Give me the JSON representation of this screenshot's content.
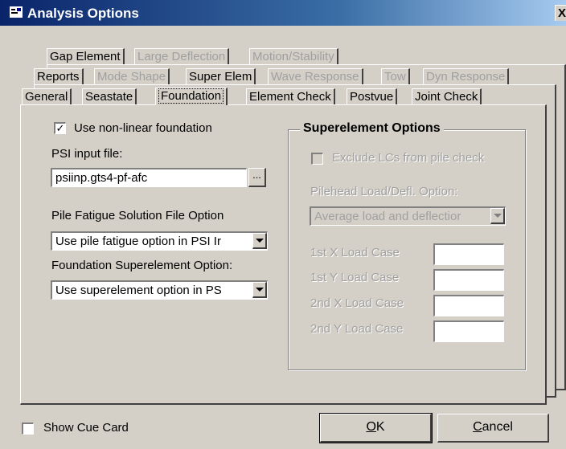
{
  "window": {
    "title": "Analysis Options",
    "close_label": "X"
  },
  "tabs": {
    "row1": [
      {
        "label": "Gap Element",
        "enabled": true
      },
      {
        "label": "Large Deflection",
        "enabled": false
      },
      {
        "label": "Motion/Stability",
        "enabled": false
      }
    ],
    "row2": [
      {
        "label": "Reports",
        "enabled": true
      },
      {
        "label": "Mode Shape",
        "enabled": false
      },
      {
        "label": "Super Elem",
        "enabled": true
      },
      {
        "label": "Wave Response",
        "enabled": false
      },
      {
        "label": "Tow",
        "enabled": false
      },
      {
        "label": "Dyn Response",
        "enabled": false
      }
    ],
    "row3": [
      {
        "label": "General",
        "enabled": true
      },
      {
        "label": "Seastate",
        "enabled": true
      },
      {
        "label": "Foundation",
        "enabled": true,
        "active": true
      },
      {
        "label": "Element Check",
        "enabled": true
      },
      {
        "label": "Postvue",
        "enabled": true
      },
      {
        "label": "Joint Check",
        "enabled": true
      }
    ]
  },
  "foundation": {
    "use_nonlinear_label": "Use non-linear foundation",
    "use_nonlinear_checked": true,
    "checkmark": "✓",
    "psi_input_label": "PSI input file:",
    "psi_input_value": "psiinp.gts4-pf-afc",
    "browse_label": "...",
    "pile_fatigue_label": "Pile Fatigue Solution File Option",
    "pile_fatigue_value": "Use pile fatigue option in PSI Ir",
    "foundation_super_label": "Foundation Superelement Option:",
    "foundation_super_value": "Use superelement option in PS"
  },
  "superelement": {
    "title": "Superelement Options",
    "exclude_label": "Exclude LCs from pile check",
    "exclude_checked": false,
    "pilehead_label": "Pilehead Load/Defl. Option:",
    "pilehead_value": "Average load and deflectior",
    "load_cases": [
      {
        "label": "1st X Load Case",
        "value": ""
      },
      {
        "label": "1st Y Load Case",
        "value": ""
      },
      {
        "label": "2nd X Load Case",
        "value": ""
      },
      {
        "label": "2nd Y Load Case",
        "value": ""
      }
    ]
  },
  "footer": {
    "show_cue_card_label": "Show Cue Card",
    "show_cue_card_checked": false,
    "ok_label": "OK",
    "ok_accel": "O",
    "ok_rest": "K",
    "cancel_label": "Cancel",
    "cancel_accel": "C",
    "cancel_rest": "ancel"
  },
  "colors": {
    "titlebar_start": "#0a246a",
    "titlebar_end": "#a6caf0",
    "dialog_bg": "#d4d0c8",
    "disabled_text": "#a0a0a0"
  }
}
